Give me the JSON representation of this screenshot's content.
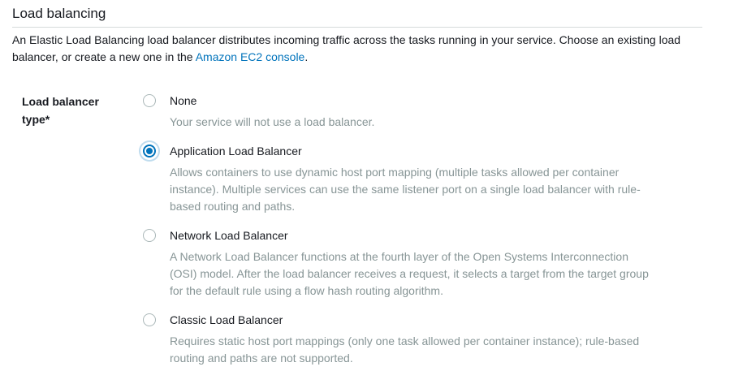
{
  "section": {
    "title": "Load balancing",
    "description_prefix": "An Elastic Load Balancing load balancer distributes incoming traffic across the tasks running in your service. Choose an existing load balancer, or create a new one in the ",
    "console_link": "Amazon EC2 console",
    "description_suffix": "."
  },
  "field": {
    "label": "Load balancer type*",
    "selected": "Application Load Balancer",
    "options": [
      {
        "label": "None",
        "description": "Your service will not use a load balancer.",
        "checked": false
      },
      {
        "label": "Application Load Balancer",
        "description": "Allows containers to use dynamic host port mapping (multiple tasks allowed per container instance). Multiple services can use the same listener port on a single load balancer with rule-based routing and paths.",
        "checked": true
      },
      {
        "label": "Network Load Balancer",
        "description": "A Network Load Balancer functions at the fourth layer of the Open Systems Interconnection (OSI) model. After the load balancer receives a request, it selects a target from the target group for the default rule using a flow hash routing algorithm.",
        "checked": false
      },
      {
        "label": "Classic Load Balancer",
        "description": "Requires static host port mappings (only one task allowed per container instance); rule-based routing and paths are not supported.",
        "checked": false
      }
    ]
  },
  "colors": {
    "accent": "#0073bb",
    "muted_text": "#879596",
    "divider": "#d5dbdb"
  }
}
